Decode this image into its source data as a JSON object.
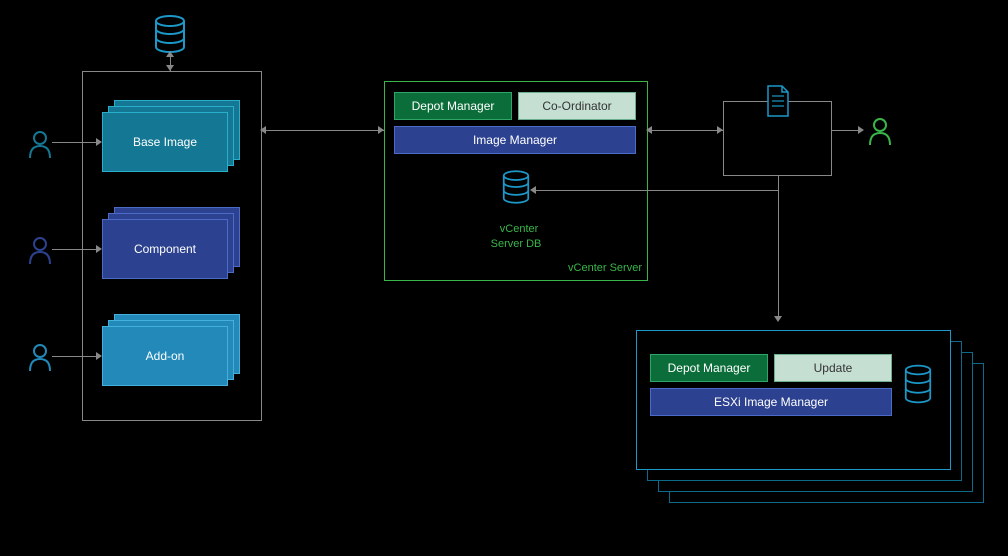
{
  "left_stack": {
    "items": [
      {
        "label": "Base Image",
        "fill": "#147793",
        "border": "#29aecc"
      },
      {
        "label": "Component",
        "fill": "#2c418f",
        "border": "#4b6bc6"
      },
      {
        "label": "Add-on",
        "fill": "#2289b8",
        "border": "#43b0dd"
      }
    ]
  },
  "vcenter": {
    "title": "vCenter Server",
    "depot": "Depot Manager",
    "coord": "Co-Ordinator",
    "image_mgr": "Image Manager",
    "db_label": "vCenter\nServer DB"
  },
  "esxi": {
    "depot": "Depot Manager",
    "update": "Update",
    "image_mgr": "ESXi Image Manager"
  },
  "intermediate_box": {}
}
